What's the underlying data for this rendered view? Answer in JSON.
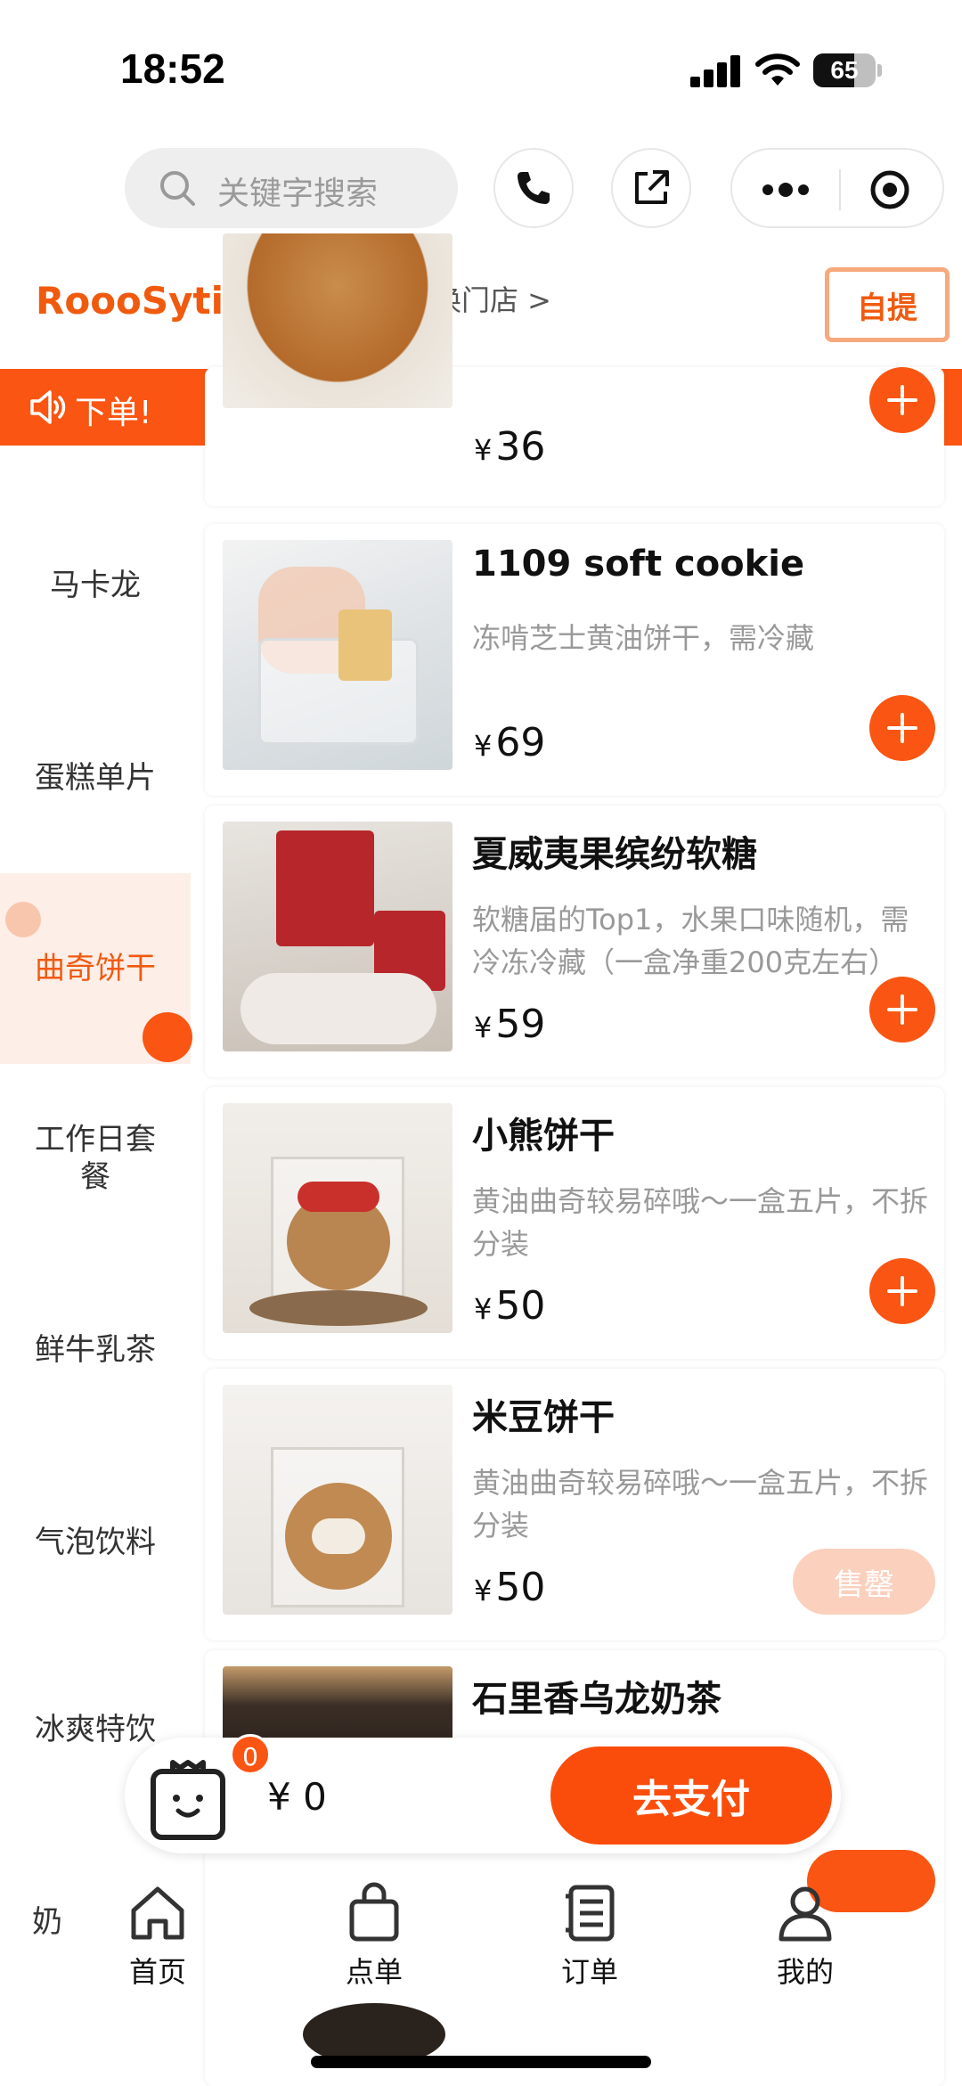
{
  "status_bar": {
    "time": "18:52",
    "battery": "65"
  },
  "search": {
    "placeholder": "关键字搜索"
  },
  "store": {
    "name": "RoooSytime甜品店",
    "switch_label": "切换门店 >",
    "pickup_label": "自提"
  },
  "notice": {
    "text": "下单!"
  },
  "categories": [
    {
      "label": "马卡龙",
      "active": false
    },
    {
      "label": "蛋糕单片",
      "active": false
    },
    {
      "label": "曲奇饼干",
      "active": true
    },
    {
      "label": "工作日套\n餐",
      "active": false
    },
    {
      "label": "鲜牛乳茶",
      "active": false
    },
    {
      "label": "气泡饮料",
      "active": false
    },
    {
      "label": "冰爽特饮",
      "active": false
    },
    {
      "label": "奶",
      "active": false
    }
  ],
  "products": [
    {
      "name": "",
      "description": "",
      "price": "36",
      "action": "add"
    },
    {
      "name": "1109 soft cookie",
      "description": "冻啃芝士黄油饼干，需冷藏",
      "price": "69",
      "action": "add"
    },
    {
      "name": "夏威夷果缤纷软糖",
      "description": "软糖届的Top1，水果口味随机，需冷冻冷藏（一盒净重200克左右）",
      "price": "59",
      "action": "add"
    },
    {
      "name": "小熊饼干",
      "description": "黄油曲奇较易碎哦～一盒五片，不拆分装",
      "price": "50",
      "action": "add"
    },
    {
      "name": "米豆饼干",
      "description": "黄油曲奇较易碎哦～一盒五片，不拆分装",
      "price": "50",
      "action": "soldout",
      "soldout_label": "售罄"
    },
    {
      "name": "石里香乌龙奶茶",
      "description": "",
      "price": "",
      "action": ""
    }
  ],
  "currency": "¥",
  "cart": {
    "count": "0",
    "total": "¥ 0",
    "pay_label": "去支付"
  },
  "tabs": [
    {
      "label": "首页",
      "icon": "home-icon"
    },
    {
      "label": "点单",
      "icon": "bag-icon"
    },
    {
      "label": "订单",
      "icon": "list-icon"
    },
    {
      "label": "我的",
      "icon": "user-icon"
    }
  ],
  "colors": {
    "accent": "#fa5512",
    "brand_text": "#f05a0f",
    "active_bg": "#fdeee7"
  }
}
